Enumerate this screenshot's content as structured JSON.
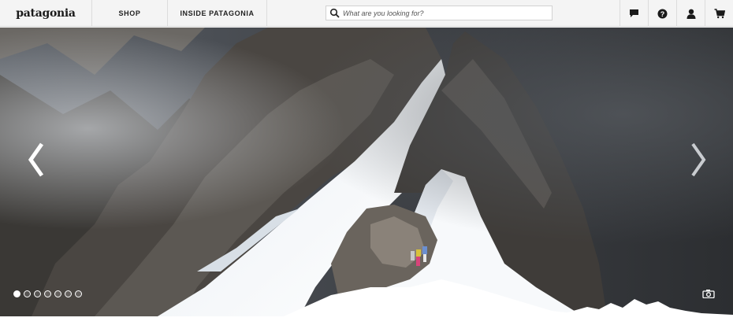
{
  "header": {
    "logo_text": "patagonia",
    "nav": [
      {
        "label": "SHOP"
      },
      {
        "label": "INSIDE PATAGONIA"
      }
    ],
    "search": {
      "placeholder": "What are you looking for?",
      "icon": "search-icon"
    },
    "icons": [
      {
        "name": "chat-icon"
      },
      {
        "name": "help-icon"
      },
      {
        "name": "account-icon"
      },
      {
        "name": "cart-icon"
      }
    ]
  },
  "hero": {
    "image": "snowy mountain ridge with climbers",
    "prev_icon": "chevron-left-icon",
    "next_icon": "chevron-right-icon",
    "slide_count": 7,
    "active_slide": 1,
    "camera_icon": "camera-icon"
  },
  "colors": {
    "header_bg": "#f4f4f4",
    "border": "#d8d8d8",
    "text": "#222222",
    "snow": "#f2f5f8",
    "rock": "#4a4642"
  }
}
